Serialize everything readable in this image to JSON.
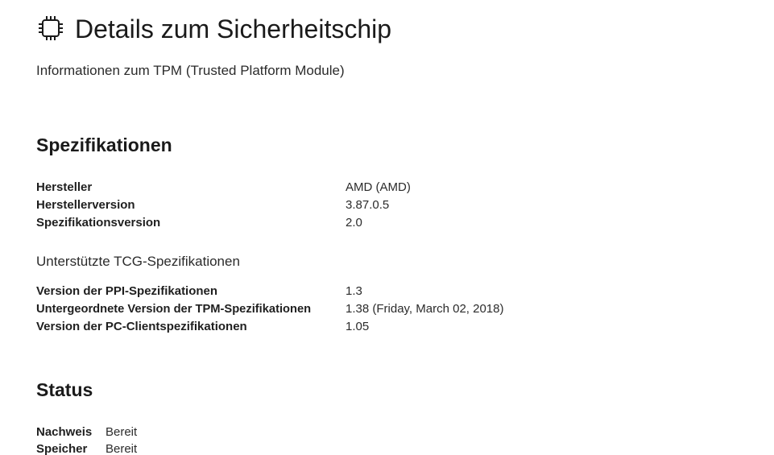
{
  "header": {
    "icon": "chip-icon",
    "title": "Details zum Sicherheitschip",
    "subtitle": "Informationen zum TPM (Trusted Platform Module)"
  },
  "specifications": {
    "heading": "Spezifikationen",
    "rows": [
      {
        "label": "Hersteller",
        "value": "AMD (AMD)"
      },
      {
        "label": "Herstellerversion",
        "value": "3.87.0.5"
      },
      {
        "label": "Spezifikationsversion",
        "value": "2.0"
      }
    ]
  },
  "tcg": {
    "heading": "Unterstützte TCG-Spezifikationen",
    "rows": [
      {
        "label": "Version der PPI-Spezifikationen",
        "value": "1.3"
      },
      {
        "label": "Untergeordnete Version der TPM-Spezifikationen",
        "value": "1.38 (Friday, March 02, 2018)"
      },
      {
        "label": "Version der PC-Clientspezifikationen",
        "value": "1.05"
      }
    ]
  },
  "status": {
    "heading": "Status",
    "rows": [
      {
        "label": "Nachweis",
        "value": "Bereit"
      },
      {
        "label": "Speicher",
        "value": "Bereit"
      }
    ]
  }
}
